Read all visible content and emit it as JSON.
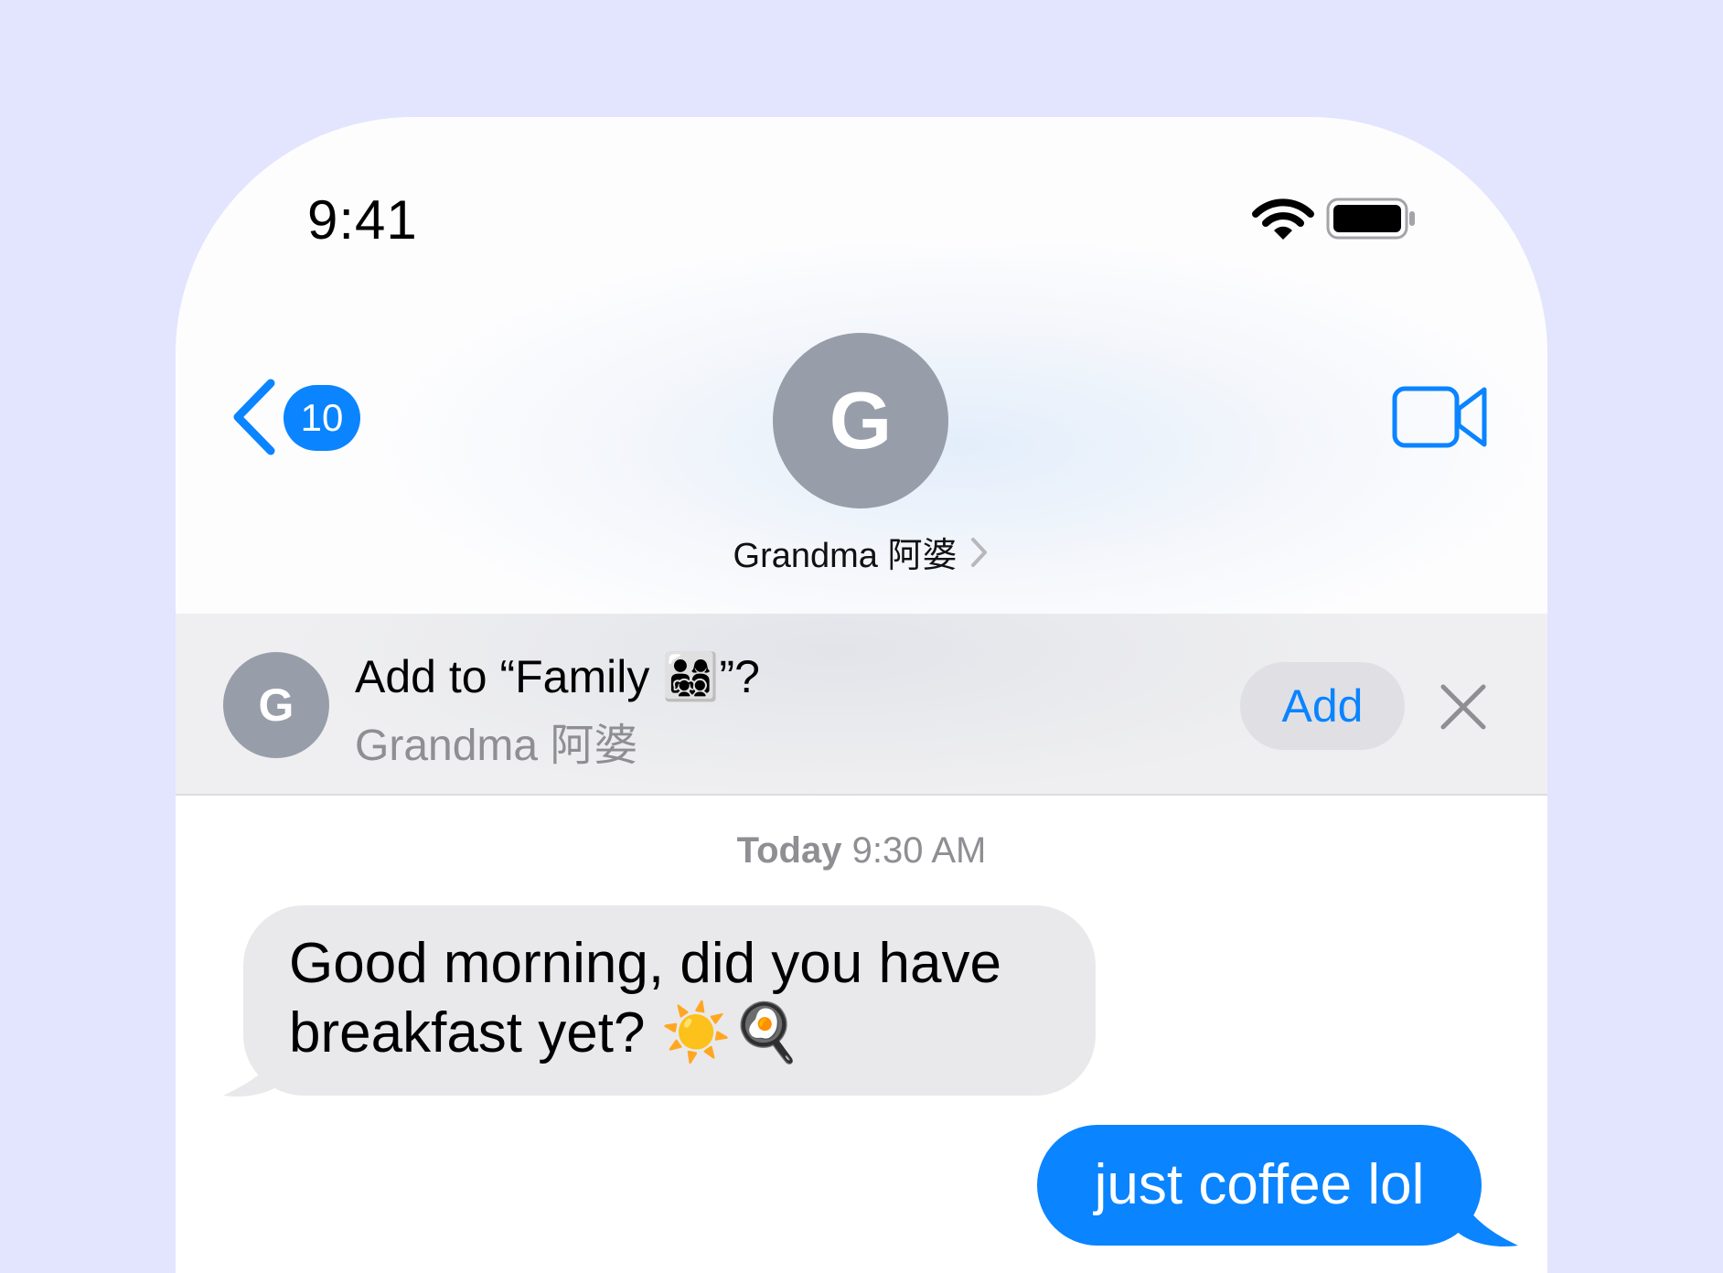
{
  "status_bar": {
    "time": "9:41"
  },
  "nav": {
    "back_badge": "10",
    "contact_initial": "G",
    "contact_name": "Grandma 阿婆"
  },
  "banner": {
    "avatar_initial": "G",
    "title": "Add to “Family 👨‍👩‍👧‍👦”?",
    "subtitle": "Grandma 阿婆",
    "add_label": "Add"
  },
  "thread": {
    "timestamp_day": "Today",
    "timestamp_time": "9:30 AM",
    "messages": [
      {
        "direction": "incoming",
        "text": "Good morning, did you have breakfast yet? ☀️🍳"
      },
      {
        "direction": "outgoing",
        "text": "just coffee lol"
      }
    ]
  },
  "colors": {
    "accent": "#0a84ff",
    "background": "#e3e5fe",
    "avatar": "#979ea9",
    "incoming_bubble": "#e9e9eb"
  }
}
